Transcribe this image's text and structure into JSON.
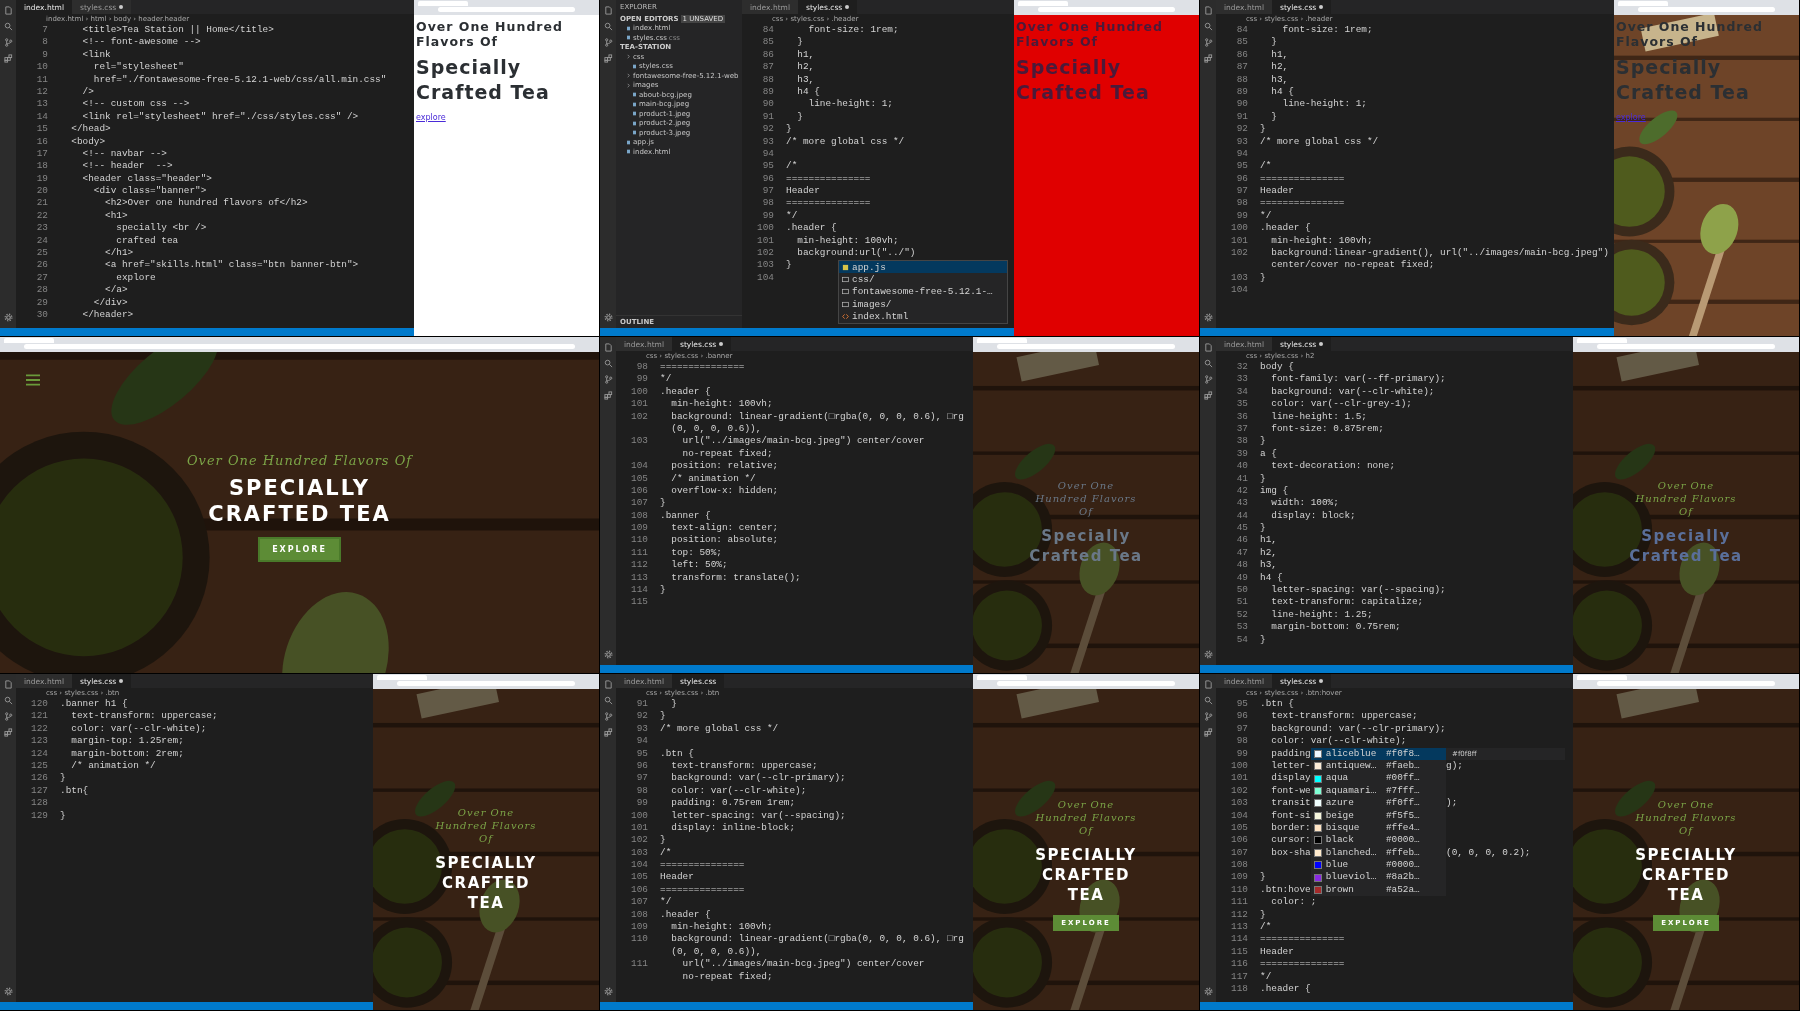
{
  "frames": [
    {
      "kind": "wide",
      "tabs": [
        {
          "label": "index.html",
          "selected": true,
          "modified": false
        },
        {
          "label": "styles.css",
          "selected": false,
          "modified": true
        }
      ],
      "breadcrumb": "index.html › html › body › header.header",
      "lines": [
        {
          "n": "7",
          "t": "    <title>Tea Station || Home</title>"
        },
        {
          "n": "8",
          "t": "    <!-- font-awesome -->"
        },
        {
          "n": "9",
          "t": "    <link"
        },
        {
          "n": "10",
          "t": "      rel=\"stylesheet\""
        },
        {
          "n": "11",
          "t": "      href=\"./fontawesome-free-5.12.1-web/css/all.min.css\""
        },
        {
          "n": "12",
          "t": "    />"
        },
        {
          "n": "13",
          "t": "    <!-- custom css -->"
        },
        {
          "n": "14",
          "t": "    <link rel=\"stylesheet\" href=\"./css/styles.css\" />"
        },
        {
          "n": "15",
          "t": "  </head>"
        },
        {
          "n": "16",
          "t": "  <body>"
        },
        {
          "n": "17",
          "t": "    <!-- navbar -->"
        },
        {
          "n": "18",
          "t": "    <!-- header  -->"
        },
        {
          "n": "19",
          "t": "    <header class=\"header\">"
        },
        {
          "n": "20",
          "t": "      <div class=\"banner\">"
        },
        {
          "n": "21",
          "t": "        <h2>Over one hundred flavors of</h2>"
        },
        {
          "n": "22",
          "t": "        <h1>"
        },
        {
          "n": "23",
          "t": "          specially <br />"
        },
        {
          "n": "24",
          "t": "          crafted tea"
        },
        {
          "n": "25",
          "t": "        </h1>"
        },
        {
          "n": "26",
          "t": "        <a href=\"skills.html\" class=\"btn banner-btn\">"
        },
        {
          "n": "27",
          "t": "          explore"
        },
        {
          "n": "28",
          "t": "        </a>"
        },
        {
          "n": "29",
          "t": "      </div>"
        },
        {
          "n": "30",
          "t": "    </header>"
        }
      ],
      "preview": {
        "kind": "plain",
        "h2": {
          "text": "Over One Hundred Flavors Of",
          "color": "#2b2f33"
        },
        "h1": {
          "text": "Specially Crafted Tea",
          "color": "#2b2f33"
        },
        "button": {
          "text": "explore",
          "kind": "link"
        }
      }
    },
    {
      "kind": "wide",
      "tabs": [
        {
          "label": "index.html",
          "selected": false,
          "modified": false
        },
        {
          "label": "styles.css",
          "selected": true,
          "modified": true
        }
      ],
      "breadcrumb": "css › styles.css › .header",
      "sidebar": {
        "title": "EXPLORER",
        "rows": [
          {
            "text": "OPEN EDITORS",
            "kind": "section",
            "badge": "1 UNSAVED",
            "children": [
              {
                "text": "index.html",
                "kind": "file"
              },
              {
                "text": "styles.css",
                "kind": "file",
                "note": "css"
              }
            ]
          },
          {
            "text": "TEA-STATION",
            "kind": "section",
            "children": [
              {
                "text": "css",
                "kind": "folder",
                "children": [
                  {
                    "text": "styles.css",
                    "kind": "file"
                  }
                ]
              },
              {
                "text": "fontawesome-free-5.12.1-web",
                "kind": "folder"
              },
              {
                "text": "images",
                "kind": "folder",
                "children": [
                  {
                    "text": "about-bcg.jpeg",
                    "kind": "file"
                  },
                  {
                    "text": "main-bcg.jpeg",
                    "kind": "file"
                  },
                  {
                    "text": "product-1.jpeg",
                    "kind": "file"
                  },
                  {
                    "text": "product-2.jpeg",
                    "kind": "file"
                  },
                  {
                    "text": "product-3.jpeg",
                    "kind": "file"
                  }
                ]
              },
              {
                "text": "app.js",
                "kind": "file"
              },
              {
                "text": "index.html",
                "kind": "file"
              }
            ]
          }
        ],
        "footer": "OUTLINE"
      },
      "lines": [
        {
          "n": "84",
          "t": "    font-size: 1rem;"
        },
        {
          "n": "85",
          "t": "  }"
        },
        {
          "n": "86",
          "t": "  h1,"
        },
        {
          "n": "87",
          "t": "  h2,"
        },
        {
          "n": "88",
          "t": "  h3,"
        },
        {
          "n": "89",
          "t": "  h4 {"
        },
        {
          "n": "90",
          "t": "    line-height: 1;"
        },
        {
          "n": "91",
          "t": "  }"
        },
        {
          "n": "92",
          "t": "}"
        },
        {
          "n": "93",
          "t": "/* more global css */"
        },
        {
          "n": "94"
        },
        {
          "n": "95",
          "t": "/*"
        },
        {
          "n": "96",
          "t": "==============="
        },
        {
          "n": "97",
          "t": "Header"
        },
        {
          "n": "98",
          "t": "==============="
        },
        {
          "n": "99",
          "t": "*/"
        },
        {
          "n": "100",
          "t": ".header {"
        },
        {
          "n": "101",
          "t": "  min-height: 100vh;"
        },
        {
          "n": "102",
          "t": "  background:url(\"../\")"
        },
        {
          "n": "103",
          "t": "}"
        },
        {
          "n": "104"
        }
      ],
      "popup": [
        {
          "label": "app.js",
          "kind": "js",
          "selected": true
        },
        {
          "label": "css/",
          "kind": "folder",
          "selected": false
        },
        {
          "label": "fontawesome-free-5.12.1-…",
          "kind": "folder",
          "selected": false
        },
        {
          "label": "images/",
          "kind": "folder",
          "selected": false
        },
        {
          "label": "index.html",
          "kind": "html",
          "selected": false
        }
      ],
      "preview": {
        "kind": "red",
        "h2": {
          "text": "Over One Hundred Flavors Of",
          "color": "#4a1a3a"
        },
        "h1": {
          "text": "Specially Crafted Tea",
          "color": "#4a1a3a"
        }
      }
    },
    {
      "kind": "wide",
      "tabs": [
        {
          "label": "index.html",
          "selected": false,
          "modified": false
        },
        {
          "label": "styles.css",
          "selected": true,
          "modified": true
        }
      ],
      "breadcrumb": "css › styles.css › .header",
      "lines": [
        {
          "n": "84",
          "t": "    font-size: 1rem;"
        },
        {
          "n": "85",
          "t": "  }"
        },
        {
          "n": "86",
          "t": "  h1,"
        },
        {
          "n": "87",
          "t": "  h2,"
        },
        {
          "n": "88",
          "t": "  h3,"
        },
        {
          "n": "89",
          "t": "  h4 {"
        },
        {
          "n": "90",
          "t": "    line-height: 1;"
        },
        {
          "n": "91",
          "t": "  }"
        },
        {
          "n": "92",
          "t": "}"
        },
        {
          "n": "93",
          "t": "/* more global css */"
        },
        {
          "n": "94"
        },
        {
          "n": "95",
          "t": "/*"
        },
        {
          "n": "96",
          "t": "==============="
        },
        {
          "n": "97",
          "t": "Header"
        },
        {
          "n": "98",
          "t": "==============="
        },
        {
          "n": "99",
          "t": "*/"
        },
        {
          "n": "100",
          "t": ".header {"
        },
        {
          "n": "101",
          "t": "  min-height: 100vh;"
        },
        {
          "n": "102",
          "t": "  background:linear-gradient(), url(\"../images/main-bcg.jpeg\")"
        },
        {
          "t": "  center/cover no-repeat fixed;"
        },
        {
          "n": "103",
          "t": "}"
        },
        {
          "n": "104"
        }
      ],
      "preview": {
        "h2": {
          "text": "Over One Hundred Flavors Of",
          "color": "#2b2f33"
        },
        "h1": {
          "text": "Specially Crafted Tea",
          "color": "#2b2f33"
        },
        "button": {
          "text": "explore",
          "kind": "link"
        }
      }
    },
    {
      "kind": "browser-only",
      "preview": {
        "kind": "dark-photo",
        "menu": true,
        "h2": {
          "text": "Over One Hundred Flavors Of",
          "color": "#7ba447"
        },
        "h1": {
          "text": "SPECIALLY CRAFTED TEA",
          "color": "#ffffff"
        },
        "button": {
          "text": "EXPLORE",
          "kind": "solid"
        }
      }
    },
    {
      "kind": "narrow",
      "tabs": [
        {
          "label": "index.html",
          "selected": false,
          "modified": false
        },
        {
          "label": "styles.css",
          "selected": true,
          "modified": true
        }
      ],
      "breadcrumb": "css › styles.css › .banner",
      "lines": [
        {
          "n": "98",
          "t": "==============="
        },
        {
          "n": "99",
          "t": "*/"
        },
        {
          "n": "100",
          "t": ".header {"
        },
        {
          "n": "101",
          "t": "  min-height: 100vh;"
        },
        {
          "n": "102",
          "t": "  background: linear-gradient(□rgba(0, 0, 0, 0.6), □rg"
        },
        {
          "t": "  (0, 0, 0, 0.6)),"
        },
        {
          "n": "103",
          "t": "    url(\"../images/main-bcg.jpeg\") center/cover"
        },
        {
          "t": "    no-repeat fixed;"
        },
        {
          "n": "104",
          "t": "  position: relative;"
        },
        {
          "n": "105",
          "t": "  /* animation */"
        },
        {
          "n": "106",
          "t": "  overflow-x: hidden;"
        },
        {
          "n": "107",
          "t": "}"
        },
        {
          "n": "108",
          "t": ".banner {"
        },
        {
          "n": "109",
          "t": "  text-align: center;"
        },
        {
          "n": "110",
          "t": "  position: absolute;"
        },
        {
          "n": "111",
          "t": "  top: 50%;"
        },
        {
          "n": "112",
          "t": "  left: 50%;"
        },
        {
          "n": "113",
          "t": "  transform: translate();"
        },
        {
          "n": "114",
          "t": "}"
        },
        {
          "n": "115"
        }
      ],
      "preview": {
        "kind": "dark-photo",
        "h2": {
          "text": "Over One Hundred Flavors Of",
          "color": "#6a7888"
        },
        "h1": {
          "text": "Specially Crafted Tea",
          "color": "#6a7888"
        }
      }
    },
    {
      "kind": "narrow",
      "tabs": [
        {
          "label": "index.html",
          "selected": false,
          "modified": false
        },
        {
          "label": "styles.css",
          "selected": true,
          "modified": true
        }
      ],
      "breadcrumb": "css › styles.css › h2",
      "lines": [
        {
          "n": "32",
          "t": "body {"
        },
        {
          "n": "33",
          "t": "  font-family: var(--ff-primary);"
        },
        {
          "n": "34",
          "t": "  background: var(--clr-white);"
        },
        {
          "n": "35",
          "t": "  color: var(--clr-grey-1);"
        },
        {
          "n": "36",
          "t": "  line-height: 1.5;"
        },
        {
          "n": "37",
          "t": "  font-size: 0.875rem;"
        },
        {
          "n": "38",
          "t": "}"
        },
        {
          "n": "39",
          "t": "a {"
        },
        {
          "n": "40",
          "t": "  text-decoration: none;"
        },
        {
          "n": "41",
          "t": "}"
        },
        {
          "n": "42",
          "t": "img {"
        },
        {
          "n": "43",
          "t": "  width: 100%;"
        },
        {
          "n": "44",
          "t": "  display: block;"
        },
        {
          "n": "45",
          "t": "}"
        },
        {
          "n": "46",
          "t": "h1,"
        },
        {
          "n": "47",
          "t": "h2,"
        },
        {
          "n": "48",
          "t": "h3,"
        },
        {
          "n": "49",
          "t": "h4 {"
        },
        {
          "n": "50",
          "t": "  letter-spacing: var(--spacing);"
        },
        {
          "n": "51",
          "t": "  text-transform: capitalize;"
        },
        {
          "n": "52",
          "t": "  line-height: 1.25;"
        },
        {
          "n": "53",
          "t": "  margin-bottom: 0.75rem;"
        },
        {
          "n": "54",
          "t": "}"
        }
      ],
      "preview": {
        "kind": "dark-photo",
        "h2": {
          "text": "Over One Hundred Flavors Of",
          "color": "#7ba447"
        },
        "h1": {
          "text": "Specially Crafted Tea",
          "color": "#5a6f9a"
        }
      }
    },
    {
      "kind": "narrow",
      "tabs": [
        {
          "label": "index.html",
          "selected": false,
          "modified": false
        },
        {
          "label": "styles.css",
          "selected": true,
          "modified": true
        }
      ],
      "breadcrumb": "css › styles.css › .btn",
      "lines": [
        {
          "n": "120",
          "t": ".banner h1 {"
        },
        {
          "n": "121",
          "t": "  text-transform: uppercase;"
        },
        {
          "n": "122",
          "t": "  color: var(--clr-white);"
        },
        {
          "n": "123",
          "t": "  margin-top: 1.25rem;"
        },
        {
          "n": "124",
          "t": "  margin-bottom: 2rem;"
        },
        {
          "n": "125",
          "t": "  /* animation */"
        },
        {
          "n": "126",
          "t": "}"
        },
        {
          "n": "127",
          "t": ".btn{"
        },
        {
          "n": "128"
        },
        {
          "n": "129",
          "t": "}"
        }
      ],
      "preview": {
        "kind": "dark-photo",
        "h2": {
          "text": "Over One Hundred Flavors Of",
          "color": "#7ba447"
        },
        "h1": {
          "text": "SPECIALLY CRAFTED TEA",
          "color": "#ffffff"
        }
      }
    },
    {
      "kind": "narrow",
      "tabs": [
        {
          "label": "index.html",
          "selected": false,
          "modified": false
        },
        {
          "label": "styles.css",
          "selected": true,
          "modified": false
        }
      ],
      "breadcrumb": "css › styles.css › .btn",
      "lines": [
        {
          "n": "91",
          "t": "  }"
        },
        {
          "n": "92",
          "t": "}"
        },
        {
          "n": "93",
          "t": "/* more global css */"
        },
        {
          "n": "94"
        },
        {
          "n": "95",
          "t": ".btn {"
        },
        {
          "n": "96",
          "t": "  text-transform: uppercase;"
        },
        {
          "n": "97",
          "t": "  background: var(--clr-primary);"
        },
        {
          "n": "98",
          "t": "  color: var(--clr-white);"
        },
        {
          "n": "99",
          "t": "  padding: 0.75rem 1rem;"
        },
        {
          "n": "100",
          "t": "  letter-spacing: var(--spacing);"
        },
        {
          "n": "101",
          "t": "  display: inline-block;"
        },
        {
          "n": "102",
          "t": "}"
        },
        {
          "n": "103",
          "t": "/*"
        },
        {
          "n": "104",
          "t": "==============="
        },
        {
          "n": "105",
          "t": "Header"
        },
        {
          "n": "106",
          "t": "==============="
        },
        {
          "n": "107",
          "t": "*/"
        },
        {
          "n": "108",
          "t": ".header {"
        },
        {
          "n": "109",
          "t": "  min-height: 100vh;"
        },
        {
          "n": "110",
          "t": "  background: linear-gradient(□rgba(0, 0, 0, 0.6), □rg"
        },
        {
          "t": "  (0, 0, 0, 0.6)),"
        },
        {
          "n": "111",
          "t": "    url(\"../images/main-bcg.jpeg\") center/cover"
        },
        {
          "t": "    no-repeat fixed;"
        }
      ],
      "preview": {
        "kind": "dark-photo",
        "h2": {
          "text": "Over One Hundred Flavors Of",
          "color": "#7ba447"
        },
        "h1": {
          "text": "SPECIALLY CRAFTED TEA",
          "color": "#ffffff"
        },
        "button": {
          "text": "EXPLORE",
          "kind": "solid"
        }
      }
    },
    {
      "kind": "narrow",
      "tabs": [
        {
          "label": "index.html",
          "selected": false,
          "modified": false
        },
        {
          "label": "styles.css",
          "selected": true,
          "modified": true
        }
      ],
      "breadcrumb": "css › styles.css › .btn:hover",
      "lines": [
        {
          "n": "95",
          "t": ".btn {"
        },
        {
          "n": "96",
          "t": "  text-transform: uppercase;"
        },
        {
          "n": "97",
          "t": "  background: var(--clr-primary);"
        },
        {
          "n": "98",
          "t": "  color: var(--clr-white);"
        },
        {
          "n": "99",
          "t": "  padding",
          "suggestion": {
            "name": "aliceblue",
            "hex": "#f0f8…",
            "color": "#f0f8ff",
            "selected": true
          },
          "detail": "#f0f8ff"
        },
        {
          "n": "100",
          "t": "  letter-",
          "suggestion": {
            "name": "antiquew…",
            "hex": "#faeb…",
            "color": "#faebd7",
            "selected": false
          },
          "tail": "g);"
        },
        {
          "n": "101",
          "t": "  display",
          "suggestion": {
            "name": "aqua",
            "hex": "#00ff…",
            "color": "#00ffff",
            "selected": false
          }
        },
        {
          "n": "102",
          "t": "  font-we",
          "suggestion": {
            "name": "aquamari…",
            "hex": "#7fff…",
            "color": "#7fffd4",
            "selected": false
          }
        },
        {
          "n": "103",
          "t": "  transit",
          "suggestion": {
            "name": "azure",
            "hex": "#f0ff…",
            "color": "#f0ffff",
            "selected": false
          },
          "tail": ");"
        },
        {
          "n": "104",
          "t": "  font-si",
          "suggestion": {
            "name": "beige",
            "hex": "#f5f5…",
            "color": "#f5f5dc",
            "selected": false
          }
        },
        {
          "n": "105",
          "t": "  border:",
          "suggestion": {
            "name": "bisque",
            "hex": "#ffe4…",
            "color": "#ffe4c4",
            "selected": false
          }
        },
        {
          "n": "106",
          "t": "  cursor:",
          "suggestion": {
            "name": "black",
            "hex": "#0000…",
            "color": "#000000",
            "selected": false
          }
        },
        {
          "n": "107",
          "t": "  box-sha",
          "suggestion": {
            "name": "blanched…",
            "hex": "#ffeb…",
            "color": "#ffebcd",
            "selected": false
          },
          "tail": "(0, 0, 0, 0.2);"
        },
        {
          "n": "108",
          "suggestion": {
            "name": "blue",
            "hex": "#0000…",
            "color": "#0000ff",
            "selected": false
          }
        },
        {
          "n": "109",
          "t": "}",
          "suggestion": {
            "name": "blueviol…",
            "hex": "#8a2b…",
            "color": "#8a2be2",
            "selected": false
          }
        },
        {
          "n": "110",
          "t": ".btn:hove",
          "suggestion": {
            "name": "brown",
            "hex": "#a52a…",
            "color": "#a52a2a",
            "selected": false
          }
        },
        {
          "n": "111",
          "t": "  color: ;"
        },
        {
          "n": "112",
          "t": "}"
        },
        {
          "n": "113",
          "t": "/*"
        },
        {
          "n": "114",
          "t": "==============="
        },
        {
          "n": "115",
          "t": "Header"
        },
        {
          "n": "116",
          "t": "==============="
        },
        {
          "n": "117",
          "t": "*/"
        },
        {
          "n": "118",
          "t": ".header {"
        }
      ],
      "preview": {
        "kind": "dark-photo",
        "h2": {
          "text": "Over One Hundred Flavors Of",
          "color": "#7ba447"
        },
        "h1": {
          "text": "SPECIALLY CRAFTED TEA",
          "color": "#ffffff"
        },
        "button": {
          "text": "EXPLORE",
          "kind": "solid"
        }
      }
    }
  ]
}
